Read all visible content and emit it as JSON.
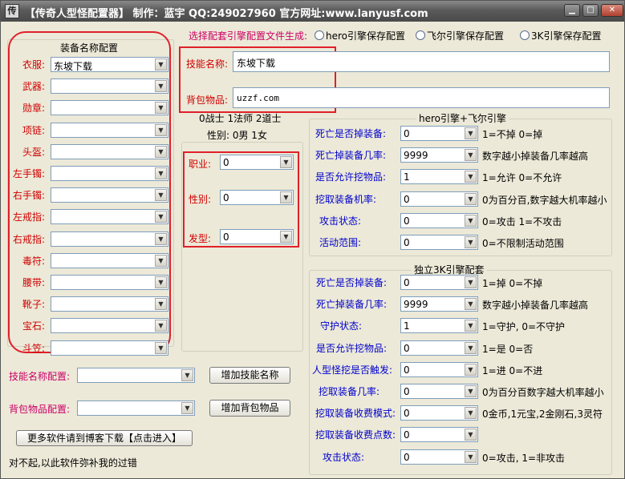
{
  "window": {
    "icon": "app-icon",
    "title": "【传奇人型怪配置器】 制作：蓝宇 QQ:249027960 官方网址:www.lanyusf.com",
    "minimize": "▁",
    "maximize": "□",
    "close": "✕"
  },
  "equip": {
    "title": "装备名称配置",
    "rows": [
      {
        "label": "衣服:",
        "value": "东坡下载"
      },
      {
        "label": "武器:",
        "value": ""
      },
      {
        "label": "勋章:",
        "value": ""
      },
      {
        "label": "项链:",
        "value": ""
      },
      {
        "label": "头盔:",
        "value": ""
      },
      {
        "label": "左手镯:",
        "value": ""
      },
      {
        "label": "右手镯:",
        "value": ""
      },
      {
        "label": "左戒指:",
        "value": ""
      },
      {
        "label": "右戒指:",
        "value": ""
      },
      {
        "label": "毒符:",
        "value": ""
      },
      {
        "label": "腰带:",
        "value": ""
      },
      {
        "label": "靴子:",
        "value": ""
      },
      {
        "label": "宝石:",
        "value": ""
      },
      {
        "label": "斗笠:",
        "value": ""
      }
    ]
  },
  "engine": {
    "label": "选择配套引擎配置文件生成:",
    "options": [
      "hero引擎保存配置",
      "飞尔引擎保存配置",
      "3K引擎保存配置"
    ]
  },
  "skill": {
    "label": "技能名称:",
    "value": "东坡下载"
  },
  "bag": {
    "label": "背包物品:",
    "value": "uzzf.com"
  },
  "profession_info": {
    "line1": "0战士 1法师 2道士",
    "line2": "性别: 0男 1女"
  },
  "profile": {
    "job": {
      "label": "职业:",
      "value": "0"
    },
    "gender": {
      "label": "性别:",
      "value": "0"
    },
    "hair": {
      "label": "发型:",
      "value": "0"
    }
  },
  "hero_panel": {
    "title": "hero引擎+飞尔引擎",
    "rows": [
      {
        "label": "死亡是否掉装备:",
        "value": "0",
        "hint": "1=不掉 0=掉"
      },
      {
        "label": "死亡掉装备几率:",
        "value": "9999",
        "hint": "数字越小掉装备几率越高"
      },
      {
        "label": "是否允许挖物品:",
        "value": "1",
        "hint": "1=允许  0=不允许"
      },
      {
        "label": "挖取装备机率:",
        "value": "0",
        "hint": "0为百分百,数字越大机率越小"
      },
      {
        "label": "攻击状态:",
        "value": "0",
        "hint": "0=攻击  1=不攻击"
      },
      {
        "label": "活动范围:",
        "value": "0",
        "hint": "0=不限制活动范围"
      }
    ]
  },
  "k3_panel": {
    "title": "独立3K引擎配套",
    "rows": [
      {
        "label": "死亡是否掉装备:",
        "value": "0",
        "hint": "1=掉  0=不掉"
      },
      {
        "label": "死亡掉装备几率:",
        "value": "9999",
        "hint": "数字越小掉装备几率越高"
      },
      {
        "label": "守护状态:",
        "value": "1",
        "hint": "1=守护, 0=不守护"
      },
      {
        "label": "是否允许挖物品:",
        "value": "0",
        "hint": "1=是  0=否"
      },
      {
        "label": "人型怪挖是否触发:",
        "value": "0",
        "hint": "1=进   0=不进"
      },
      {
        "label": "挖取装备几率:",
        "value": "0",
        "hint": "0为百分百数字越大机率越小"
      },
      {
        "label": "挖取装备收费模式:",
        "value": "0",
        "hint": "0金币,1元宝,2金刚石,3灵符"
      },
      {
        "label": "挖取装备收费点数:",
        "value": "0",
        "hint": ""
      },
      {
        "label": "攻击状态:",
        "value": "0",
        "hint": "0=攻击, 1=非攻击"
      }
    ]
  },
  "skill_config": {
    "label": "技能名称配置:",
    "value": "",
    "button": "增加技能名称"
  },
  "bag_config": {
    "label": "背包物品配置:",
    "value": "",
    "button": "增加背包物品"
  },
  "more_button": "更多软件请到博客下载【点击进入】",
  "footer_note": "对不起,以此软件弥补我的过错"
}
